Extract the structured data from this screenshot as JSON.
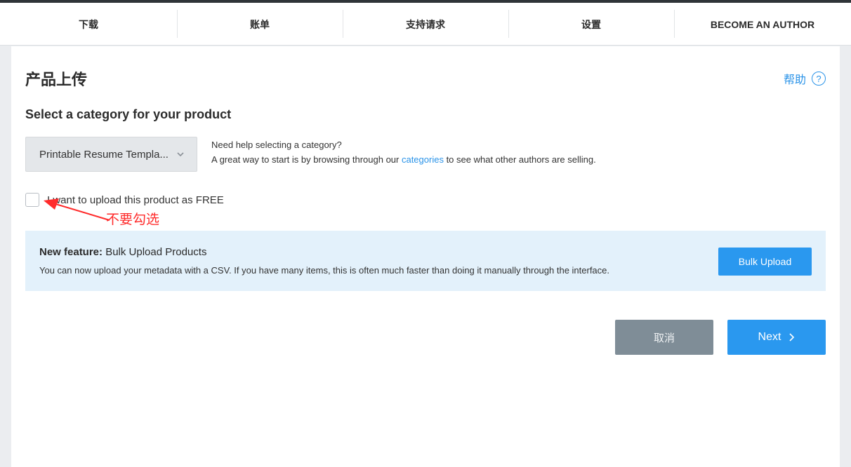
{
  "nav": {
    "items": [
      {
        "label": "下载"
      },
      {
        "label": "账单"
      },
      {
        "label": "支持请求"
      },
      {
        "label": "设置"
      },
      {
        "label": "BECOME AN AUTHOR"
      }
    ]
  },
  "page": {
    "title": "产品上传",
    "help_label": "帮助",
    "help_icon": "question-circle-icon"
  },
  "category": {
    "heading": "Select a category for your product",
    "selected": "Printable Resume Templa...",
    "help_line1": "Need help selecting a category?",
    "help_line2_prefix": "A great way to start is by browsing through our ",
    "help_link": "categories",
    "help_line2_suffix": " to see what other authors are selling."
  },
  "free_option": {
    "label": "I want to upload this product as FREE",
    "checked": false
  },
  "annotation": {
    "text": "不要勾选",
    "color": "#ff2b2b"
  },
  "feature": {
    "title_bold": "New feature:",
    "title_rest": " Bulk Upload Products",
    "description": "You can now upload your metadata with a CSV. If you have many items, this is often much faster than doing it manually through the interface.",
    "button_label": "Bulk Upload"
  },
  "actions": {
    "cancel_label": "取消",
    "next_label": "Next"
  },
  "colors": {
    "accent": "#2a98ef",
    "link": "#2a93e8",
    "cancel": "#7f8d97",
    "feature_bg": "#e3f1fb"
  }
}
